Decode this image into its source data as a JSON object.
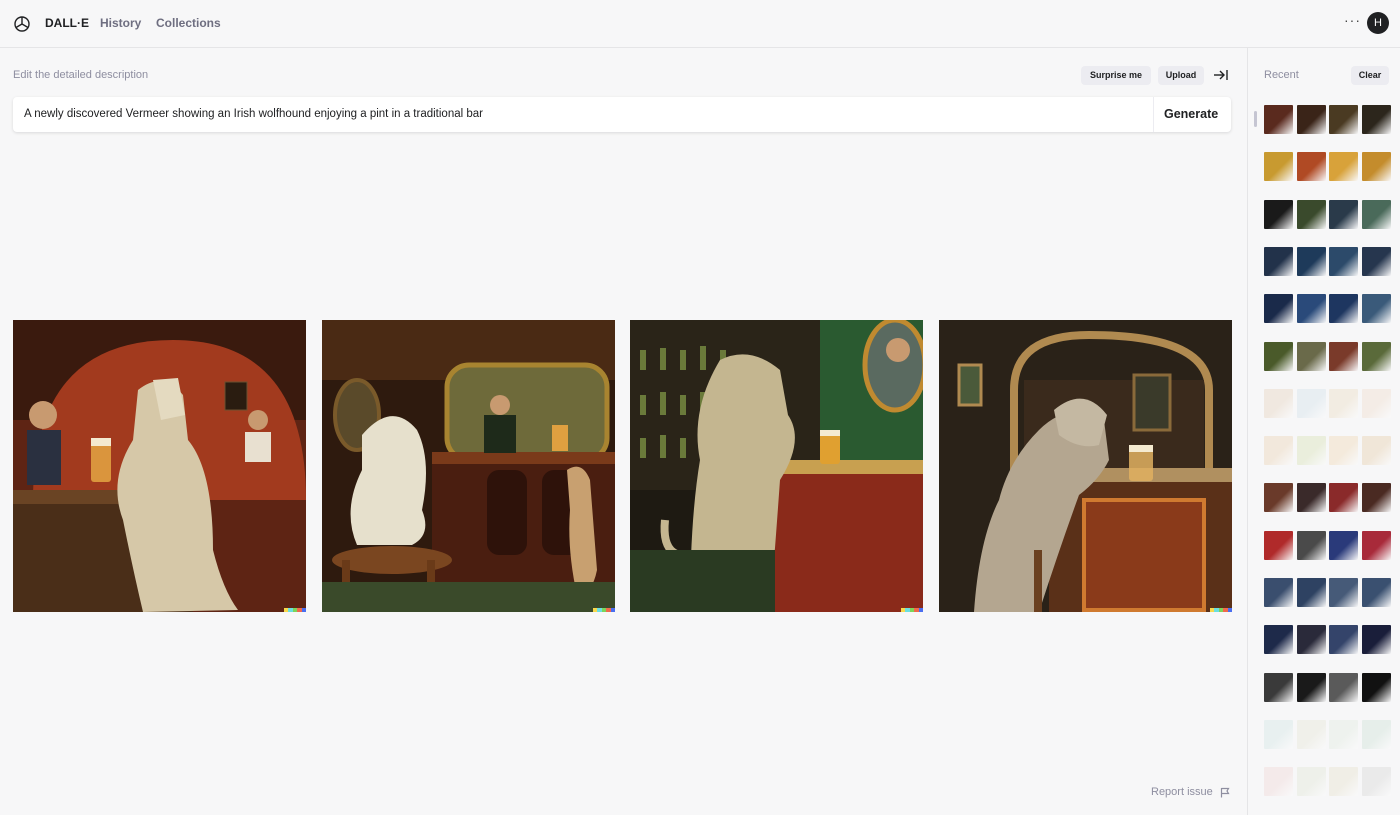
{
  "nav": {
    "app_name": "DALL·E",
    "history": "History",
    "collections": "Collections",
    "more": "···",
    "avatar_initial": "H"
  },
  "editor": {
    "label": "Edit the detailed description",
    "surprise_label": "Surprise me",
    "upload_label": "Upload",
    "prompt": "A newly discovered Vermeer showing an Irish wolfhound enjoying a pint in a traditional bar",
    "generate_label": "Generate"
  },
  "results": [
    {
      "name": "result-image-1",
      "bg": "#7a2a18",
      "accent": "#c8a87c"
    },
    {
      "name": "result-image-2",
      "bg": "#3a1e10",
      "accent": "#d9d2b8"
    },
    {
      "name": "result-image-3",
      "bg": "#2c2a18",
      "accent": "#c9bb96"
    },
    {
      "name": "result-image-4",
      "bg": "#2e241a",
      "accent": "#a89a86"
    }
  ],
  "footer": {
    "report_label": "Report issue"
  },
  "sidebar": {
    "recent_label": "Recent",
    "clear_label": "Clear",
    "rows": [
      [
        "#5a2a1e",
        "#3a2418",
        "#4a3a22",
        "#2c261c"
      ],
      [
        "#c89a30",
        "#b04a24",
        "#d8a23a",
        "#c48c2c"
      ],
      [
        "#1a1a1a",
        "#3a4a2c",
        "#2a3a4a",
        "#4a6a5a"
      ],
      [
        "#22324a",
        "#1e3a5a",
        "#2c4a6a",
        "#26364e"
      ],
      [
        "#1a2a4a",
        "#2a4a7a",
        "#1e3660",
        "#3a5a7a"
      ],
      [
        "#4a5a2a",
        "#6a6a4a",
        "#7a3a2a",
        "#5a6a3a"
      ],
      [
        "#f0e8e0",
        "#e8eef2",
        "#f2ece2",
        "#f4ece6"
      ],
      [
        "#f2e8dc",
        "#eaeedc",
        "#f4eadc",
        "#f0e6d8"
      ],
      [
        "#6a3a2a",
        "#3a2a2a",
        "#8a2a2a",
        "#4a2a22"
      ],
      [
        "#b02a2a",
        "#4a4a4a",
        "#2a3a7a",
        "#a82a3a"
      ],
      [
        "#3a4e6e",
        "#2e4262",
        "#465a78",
        "#3a5070"
      ],
      [
        "#1e2a4a",
        "#2a2a3a",
        "#34446a",
        "#1a1e3a"
      ],
      [
        "#3a3a3a",
        "#1a1a1a",
        "#5a5a5a",
        "#111111"
      ],
      [
        "#e8f0f0",
        "#f0f0ea",
        "#eef2ee",
        "#e6eeea"
      ],
      [
        "#f4eaea",
        "#eef0ea",
        "#f0eee6",
        "#eaeaea"
      ]
    ]
  }
}
